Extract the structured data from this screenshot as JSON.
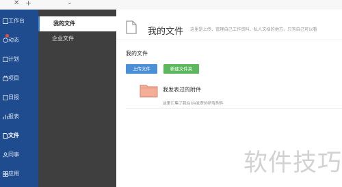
{
  "nav": {
    "items": [
      {
        "label": "工作台",
        "icon": "workbench-icon",
        "badge": false
      },
      {
        "label": "动态",
        "icon": "activity-icon",
        "badge": true
      },
      {
        "label": "计划",
        "icon": "plan-icon",
        "badge": false
      },
      {
        "label": "项目",
        "icon": "project-icon",
        "badge": false
      },
      {
        "label": "日报",
        "icon": "daily-report-icon",
        "badge": false
      },
      {
        "label": "报表",
        "icon": "report-icon",
        "badge": false
      },
      {
        "label": "文件",
        "icon": "file-icon",
        "badge": false
      },
      {
        "label": "同事",
        "icon": "colleague-icon",
        "badge": false
      },
      {
        "label": "应用",
        "icon": "apps-icon",
        "badge": false
      }
    ],
    "active_index": 6
  },
  "sub_nav": {
    "items": [
      {
        "label": "我的文件"
      },
      {
        "label": "企业文件"
      }
    ],
    "active_index": 0
  },
  "content": {
    "title": "我的文件",
    "description": "这里是上传、管理自己工作资料、私人文档的地方，只有自己可以看",
    "section_title": "我的文件",
    "upload_button": "上传文件",
    "new_folder_button": "新建文件夹",
    "folder": {
      "name": "我发表过的附件",
      "description": "这里汇集了我在Ua发表的所有附件"
    }
  },
  "watermark": "软件技巧",
  "colors": {
    "nav_bg": "#1f4c8e",
    "subnav_bg": "#3f3f3f",
    "upload_btn": "#4a90d9",
    "new_folder_btn": "#5cb85c",
    "folder": "#f0a08a",
    "badge": "#e94b3c"
  }
}
